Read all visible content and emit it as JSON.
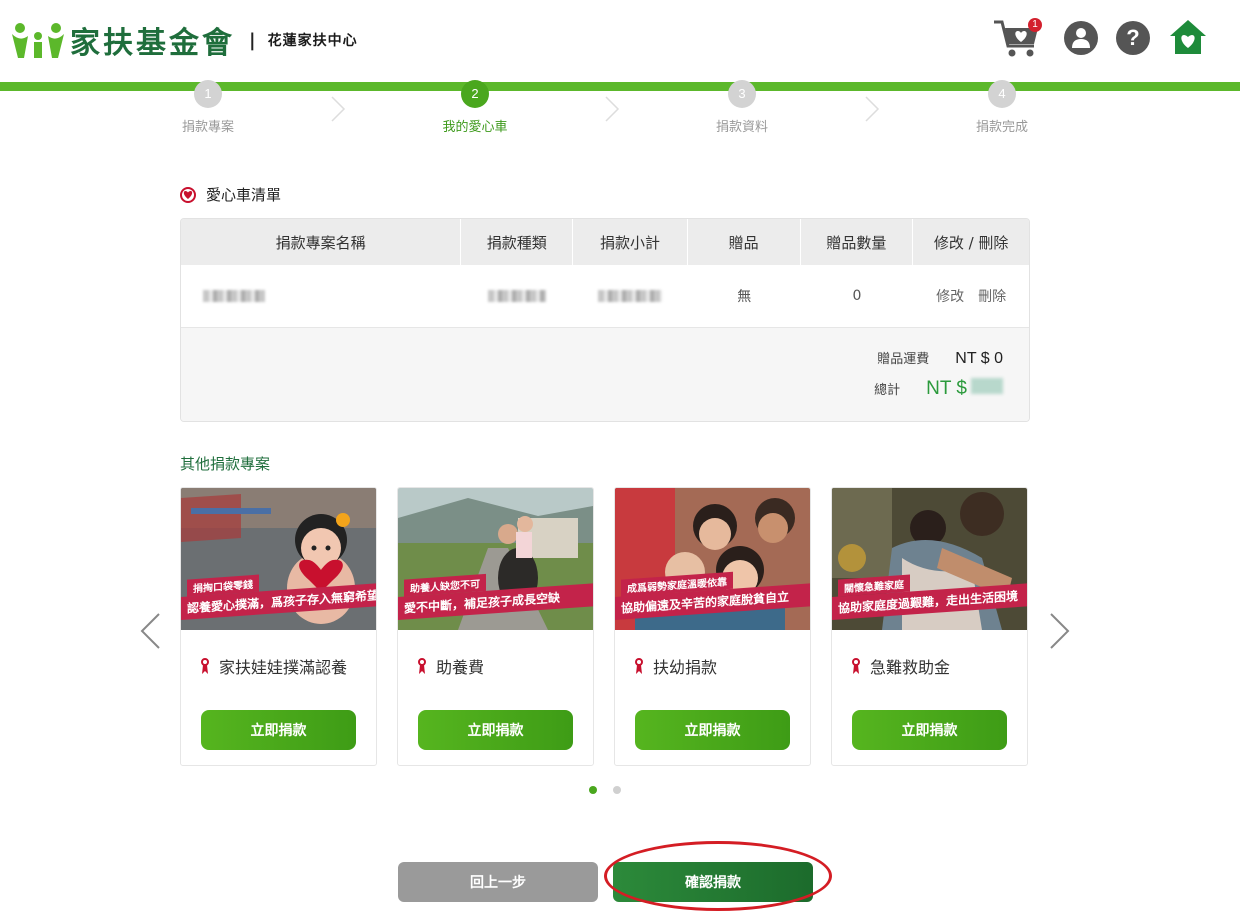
{
  "header": {
    "logo_title": "家扶基金會",
    "separator": "|",
    "subtitle": "花蓮家扶中心",
    "cart_count": "1",
    "help_glyph": "?",
    "icons": [
      "cart-icon",
      "user-icon",
      "help-icon",
      "home-heart-icon"
    ],
    "brand_color": "#1f6e3c",
    "accent_color": "#5cb82b"
  },
  "steps": [
    {
      "number": "1",
      "label": "捐款專案",
      "active": false
    },
    {
      "number": "2",
      "label": "我的愛心車",
      "active": true
    },
    {
      "number": "3",
      "label": "捐款資料",
      "active": false
    },
    {
      "number": "4",
      "label": "捐款完成",
      "active": false
    }
  ],
  "cart": {
    "title": "愛心車清單",
    "columns": [
      "捐款專案名稱",
      "捐款種類",
      "捐款小計",
      "贈品",
      "贈品數量",
      "修改 / 刪除"
    ],
    "row": {
      "gift": "無",
      "gift_qty": "0",
      "edit": "修改",
      "delete": "刪除"
    },
    "shipping_label": "贈品運費",
    "shipping_value": "NT $ 0",
    "total_label": "總計",
    "total_prefix": "NT $",
    "total_color": "#2b9a3c"
  },
  "other": {
    "title": "其他捐款專案",
    "cards": [
      {
        "banner_top": "捐掏口袋零錢",
        "banner_main": "認養愛心撲滿，爲孩子存入無窮希望",
        "name": "家扶娃娃撲滿認養",
        "button": "立即捐款"
      },
      {
        "banner_top": "助養人缺您不可",
        "banner_main": "愛不中斷，補足孩子成長空缺",
        "name": "助養費",
        "button": "立即捐款"
      },
      {
        "banner_top": "成爲弱勢家庭溫暖依靠",
        "banner_main": "協助偏遠及辛苦的家庭脫貧自立",
        "name": "扶幼捐款",
        "button": "立即捐款"
      },
      {
        "banner_top": "關懷急難家庭",
        "banner_main": "協助家庭度過艱難，走出生活困境",
        "name": "急難救助金",
        "button": "立即捐款"
      }
    ]
  },
  "buttons": {
    "back": "回上一步",
    "confirm": "確認捐款"
  }
}
